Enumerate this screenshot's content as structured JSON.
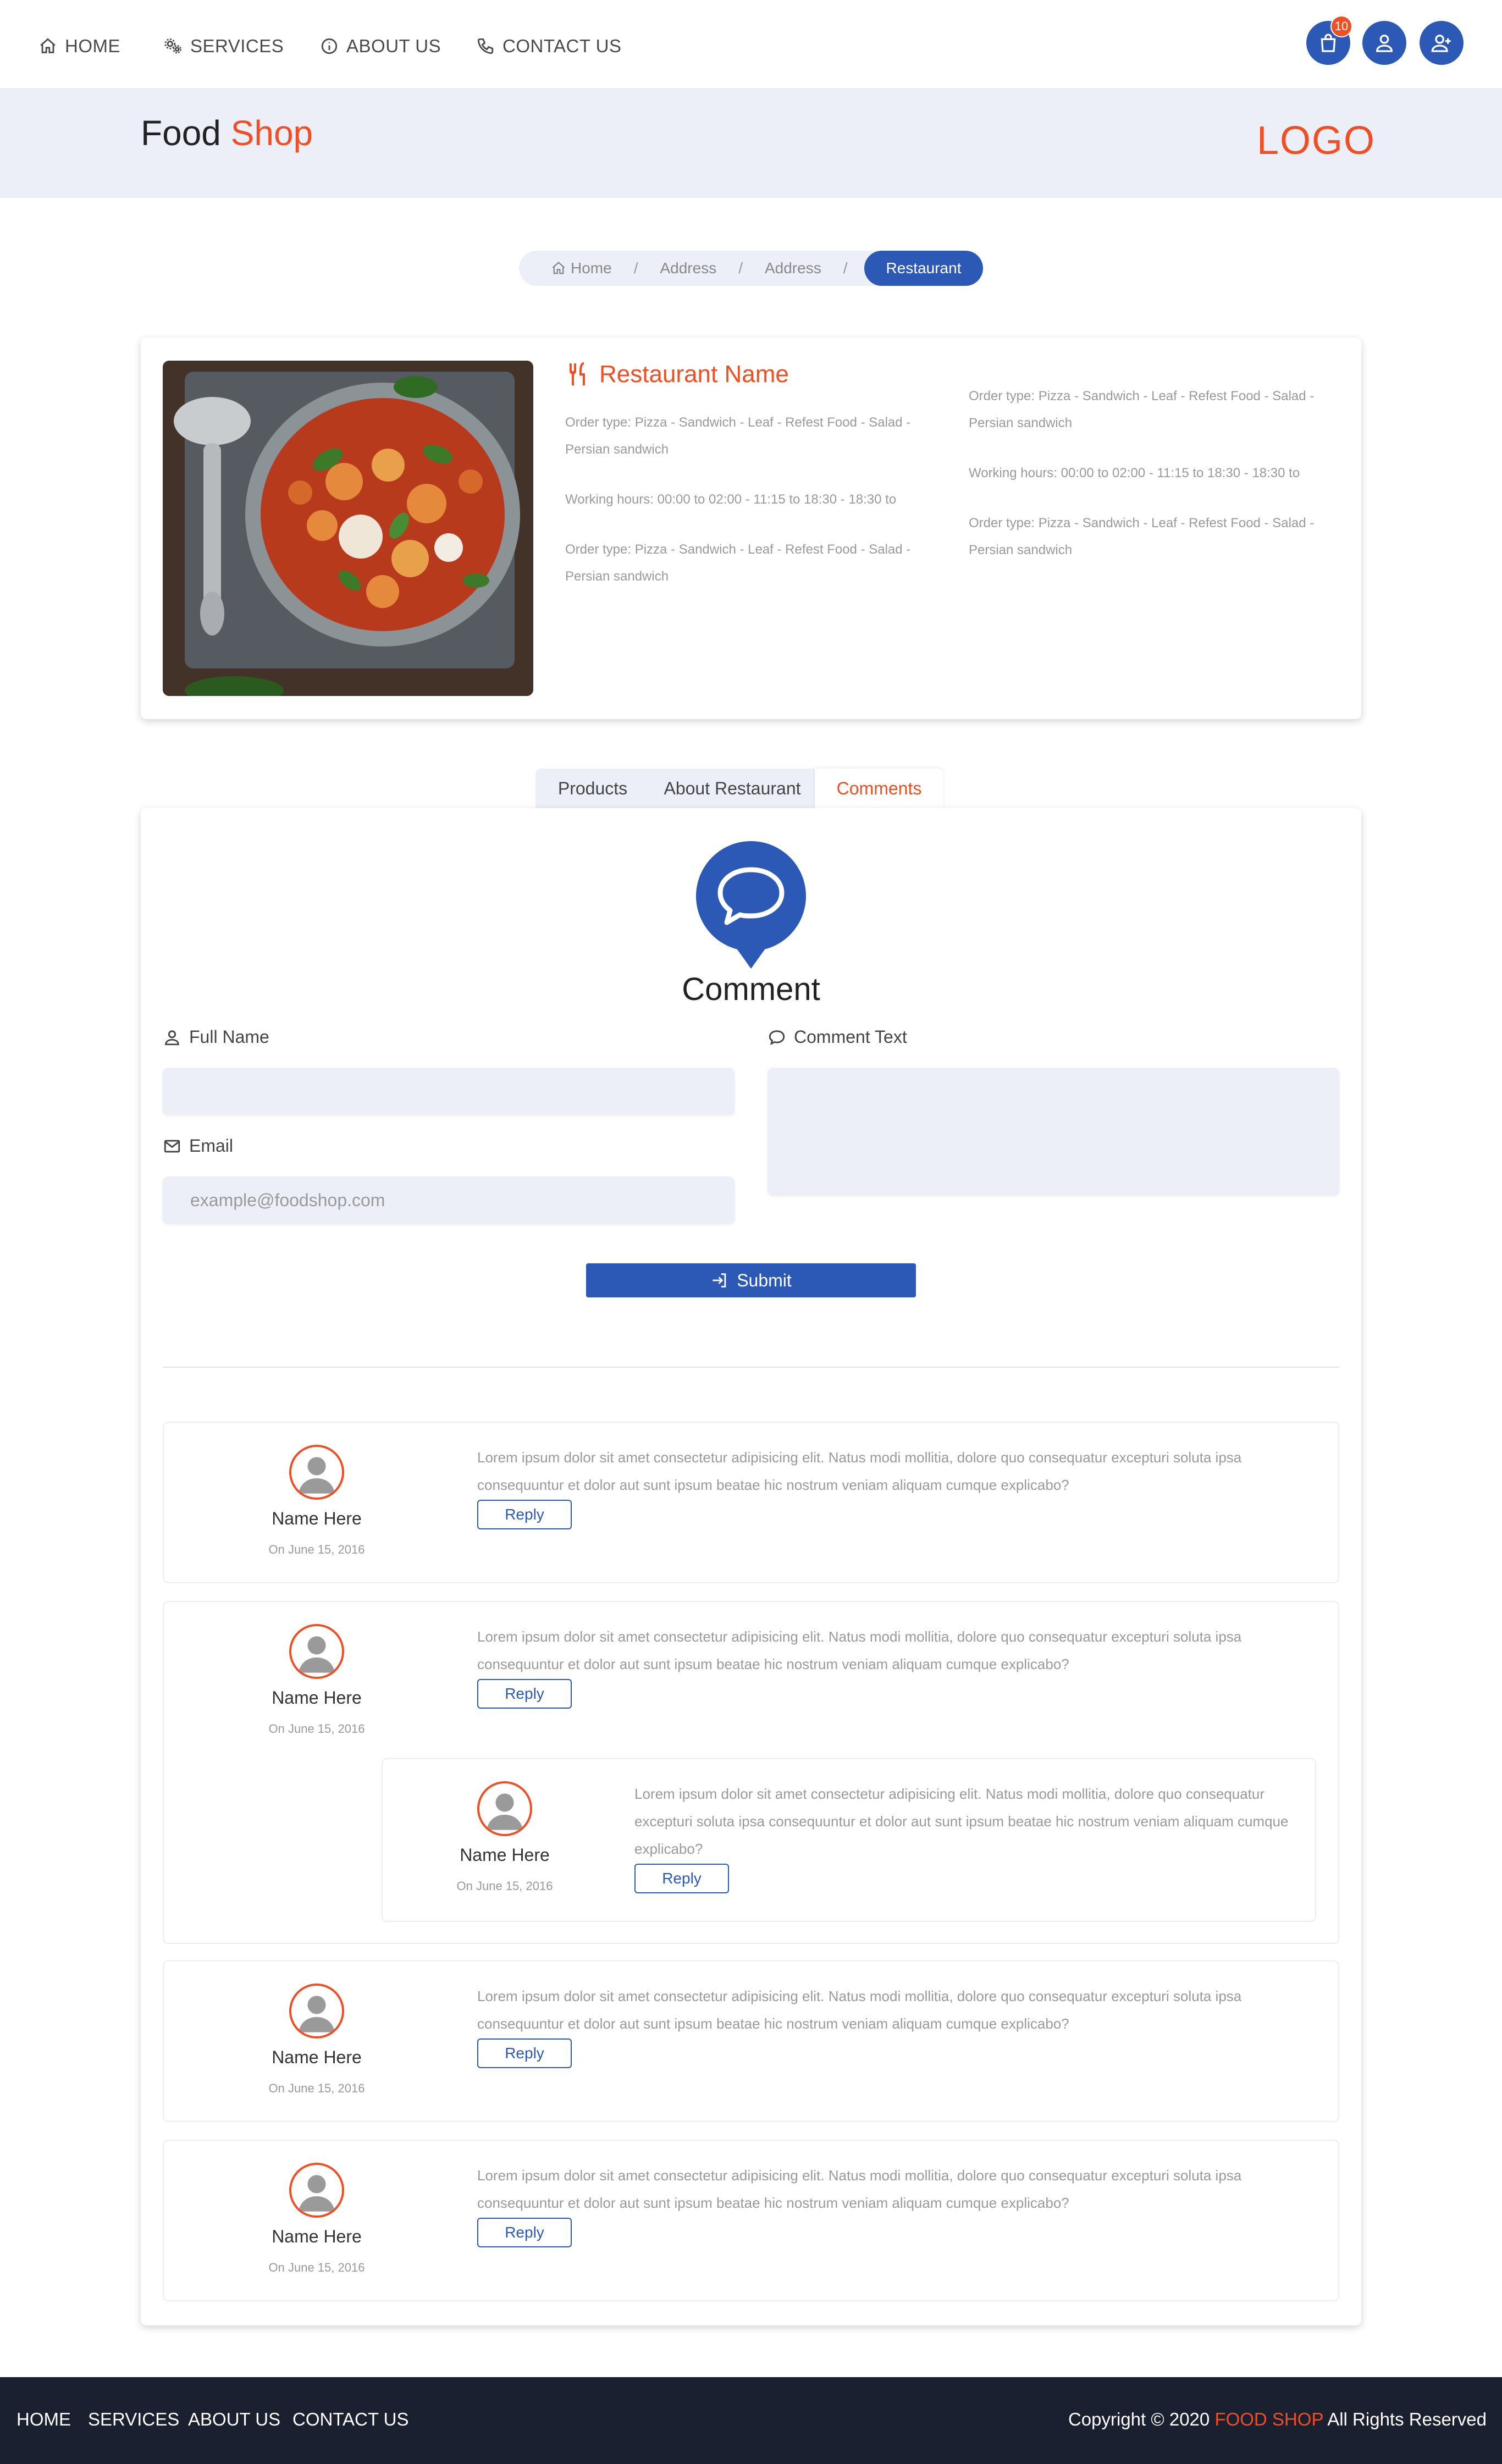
{
  "nav": {
    "home": "HOME",
    "services": "SERVICES",
    "about": "ABOUT US",
    "contact": "CONTACT US",
    "cart_count": "10"
  },
  "header": {
    "brand_main": "Food",
    "brand_accent": "Shop",
    "logo": "LOGO"
  },
  "breadcrumb": {
    "items": [
      "Home",
      "Address",
      "Address"
    ],
    "separator": "/",
    "active": "Restaurant"
  },
  "restaurant": {
    "name": "Restaurant Name",
    "left_info": [
      "Order type: Pizza - Sandwich - Leaf - Refest Food - Salad - Persian sandwich",
      "Working hours: 00:00 to 02:00 - 11:15 to 18:30 - 18:30 to",
      "Order type: Pizza - Sandwich - Leaf - Refest Food - Salad - Persian sandwich"
    ],
    "right_info": [
      "Order type: Pizza - Sandwich - Leaf - Refest Food - Salad - Persian sandwich",
      "Working hours: 00:00 to 02:00 - 11:15 to 18:30 - 18:30 to",
      "Order type: Pizza - Sandwich - Leaf - Refest Food - Salad - Persian sandwich"
    ]
  },
  "tabs": [
    "Products",
    "About Restaurant",
    "Comments"
  ],
  "comment_form": {
    "heading": "Comment",
    "full_name_label": "Full Name",
    "full_name_placeholder": "",
    "email_label": "Email",
    "email_placeholder": "example@foodshop.com",
    "comment_text_label": "Comment Text",
    "submit_label": "Submit"
  },
  "comments": [
    {
      "name": "Name Here",
      "date": "On June 15, 2016",
      "text": "Lorem ipsum dolor sit amet consectetur adipisicing elit. Natus modi mollitia, dolore quo consequatur excepturi soluta ipsa consequuntur et dolor aut sunt ipsum beatae hic nostrum veniam aliquam cumque explicabo?",
      "reply": "Reply"
    },
    {
      "name": "Name Here",
      "date": "On June 15, 2016",
      "text": "Lorem ipsum dolor sit amet consectetur adipisicing elit. Natus modi mollitia, dolore quo consequatur excepturi soluta ipsa consequuntur et dolor aut sunt ipsum beatae hic nostrum veniam aliquam cumque explicabo?",
      "reply": "Reply",
      "nested": {
        "name": "Name Here",
        "date": "On June 15, 2016",
        "text": "Lorem ipsum dolor sit amet consectetur adipisicing elit. Natus modi mollitia, dolore quo consequatur excepturi soluta ipsa consequuntur et dolor aut sunt ipsum beatae hic nostrum veniam aliquam cumque explicabo?",
        "reply": "Reply"
      }
    },
    {
      "name": "Name Here",
      "date": "On June 15, 2016",
      "text": "Lorem ipsum dolor sit amet consectetur adipisicing elit. Natus modi mollitia, dolore quo consequatur excepturi soluta ipsa consequuntur et dolor aut sunt ipsum beatae hic nostrum veniam aliquam cumque explicabo?",
      "reply": "Reply"
    },
    {
      "name": "Name Here",
      "date": "On June 15, 2016",
      "text": "Lorem ipsum dolor sit amet consectetur adipisicing elit. Natus modi mollitia, dolore quo consequatur excepturi soluta ipsa consequuntur et dolor aut sunt ipsum beatae hic nostrum veniam aliquam cumque explicabo?",
      "reply": "Reply"
    }
  ],
  "footer": {
    "links": [
      "HOME",
      "SERVICES",
      "ABOUT US",
      "CONTACT US"
    ],
    "copyright_prefix": "Copyright © 2020",
    "copyright_brand": "FOOD SHOP",
    "copyright_suffix": "All Rights Reserved"
  },
  "colors": {
    "primary": "#2b59b5",
    "accent": "#f04e23",
    "band": "#eceff8",
    "footer": "#1b2030"
  },
  "icons": {
    "home": "home-icon",
    "services": "gears-icon",
    "about": "info-icon",
    "contact": "phone-icon",
    "cart": "shopping-bag-icon",
    "user": "user-icon",
    "add_user": "user-plus-icon",
    "restaurant": "utensils-icon",
    "comment": "speech-bubble-icon",
    "email": "envelope-icon",
    "submit": "sign-in-icon"
  }
}
